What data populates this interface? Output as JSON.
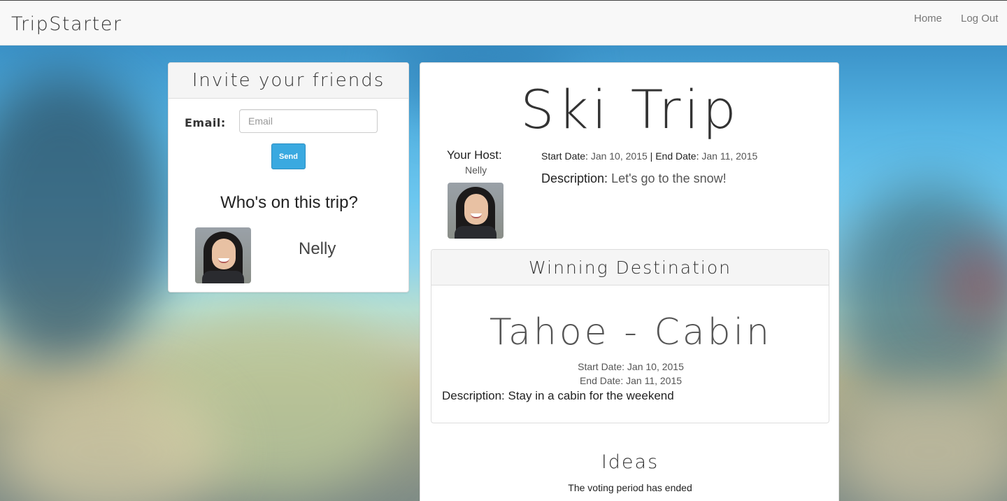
{
  "navbar": {
    "brand": "TripStarter",
    "links": [
      "Home",
      "Log Out"
    ]
  },
  "invite": {
    "heading": "Invite your friends",
    "email_label": "Email:",
    "email_placeholder": "Email",
    "email_value": "",
    "send_label": "Send",
    "who_title": "Who's on this trip?",
    "guests": [
      {
        "name": "Nelly"
      }
    ]
  },
  "trip": {
    "title": "Ski Trip",
    "host_label": "Your Host:",
    "host_name": "Nelly",
    "start_label": "Start Date:",
    "start_value": "Jan 10, 2015",
    "separator": "|",
    "end_label": "End Date:",
    "end_value": "Jan 11, 2015",
    "description_label": "Description:",
    "description_value": "Let's go to the snow!"
  },
  "winning": {
    "heading": "Winning Destination",
    "title": "Tahoe - Cabin",
    "start_date": "Start Date: Jan 10, 2015",
    "end_date": "End Date: Jan 11, 2015",
    "description": "Description: Stay in a cabin for the weekend"
  },
  "ideas": {
    "heading": "Ideas",
    "status": "The voting period has ended"
  }
}
